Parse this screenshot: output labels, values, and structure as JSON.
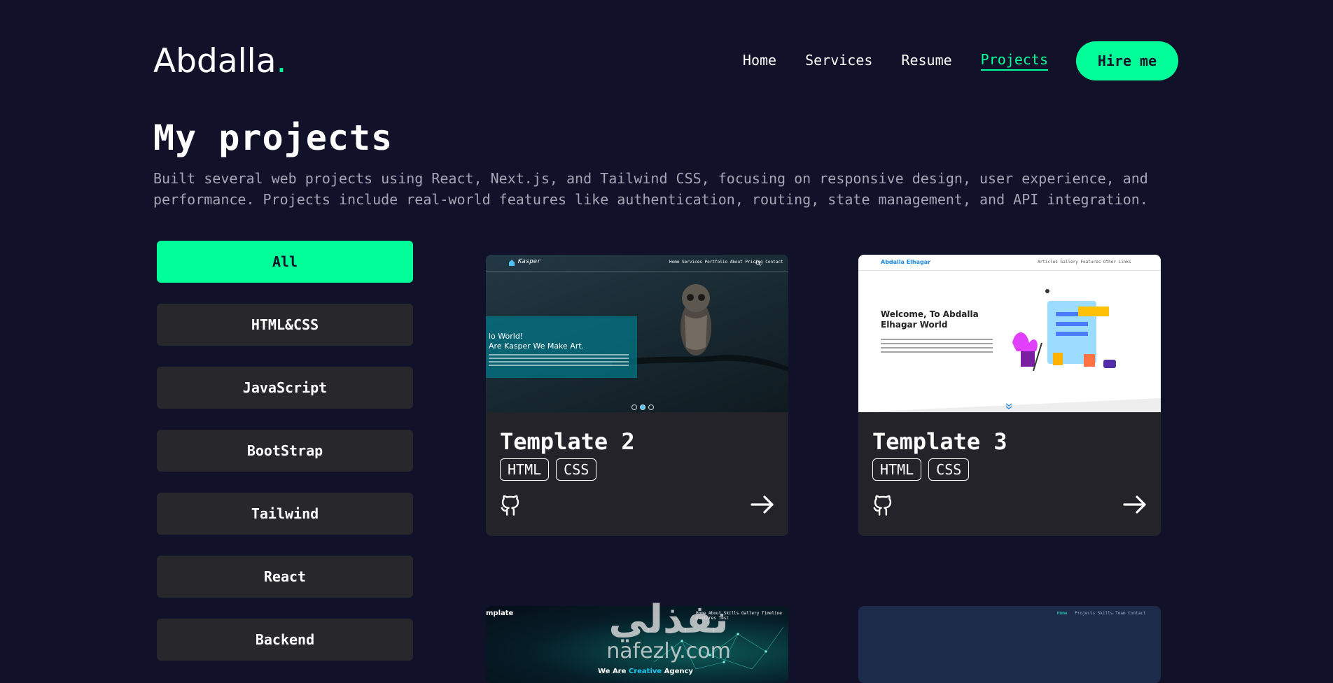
{
  "header": {
    "logo_text": "Abdalla",
    "logo_dot": ".",
    "nav": [
      {
        "label": "Home"
      },
      {
        "label": "Services"
      },
      {
        "label": "Resume"
      },
      {
        "label": "Projects"
      }
    ],
    "hire_label": "Hire me"
  },
  "main": {
    "title": "My projects",
    "intro": "Built several web projects using React, Next.js, and Tailwind CSS, focusing on responsive design, user experience, and performance. Projects include real-world features like authentication, routing, state management, and API integration."
  },
  "filters": [
    {
      "label": "All",
      "active": true
    },
    {
      "label": "HTML&CSS"
    },
    {
      "label": "JavaScript"
    },
    {
      "label": "BootStrap"
    },
    {
      "label": "Tailwind"
    },
    {
      "label": "React"
    },
    {
      "label": "Backend"
    }
  ],
  "projects": [
    {
      "title": "Template 2",
      "tags": [
        "HTML",
        "CSS"
      ],
      "thumb": {
        "brand": "Kasper",
        "nav": "Home  Services  Portfolio  About  Pricing  Contact",
        "line1": "lo World!",
        "line2": "Are Kasper We Make Art."
      }
    },
    {
      "title": "Template 3",
      "tags": [
        "HTML",
        "CSS"
      ],
      "thumb": {
        "brand": "Abdalla Elhagar",
        "nav": "Articles   Gallery   Features   Other Links",
        "heading": "Welcome, To Abdalla Elhagar World"
      }
    },
    {
      "thumb": {
        "brand": "mplate",
        "nav": "Home  About  Skills  Gallery  Timeline  Features  Test",
        "hero_a": "We Are ",
        "hero_b": "Creative",
        "hero_c": " Agency"
      }
    },
    {
      "thumb": {
        "nav_active": "Home",
        "nav": "Projects   Skills   Team   Contact"
      }
    }
  ],
  "watermark": {
    "arabic": "نفذلي",
    "latin": "nafezly.com"
  },
  "colors": {
    "background": "#111129",
    "accent": "#00ff99",
    "card": "#232329",
    "filter": "#27272c"
  }
}
